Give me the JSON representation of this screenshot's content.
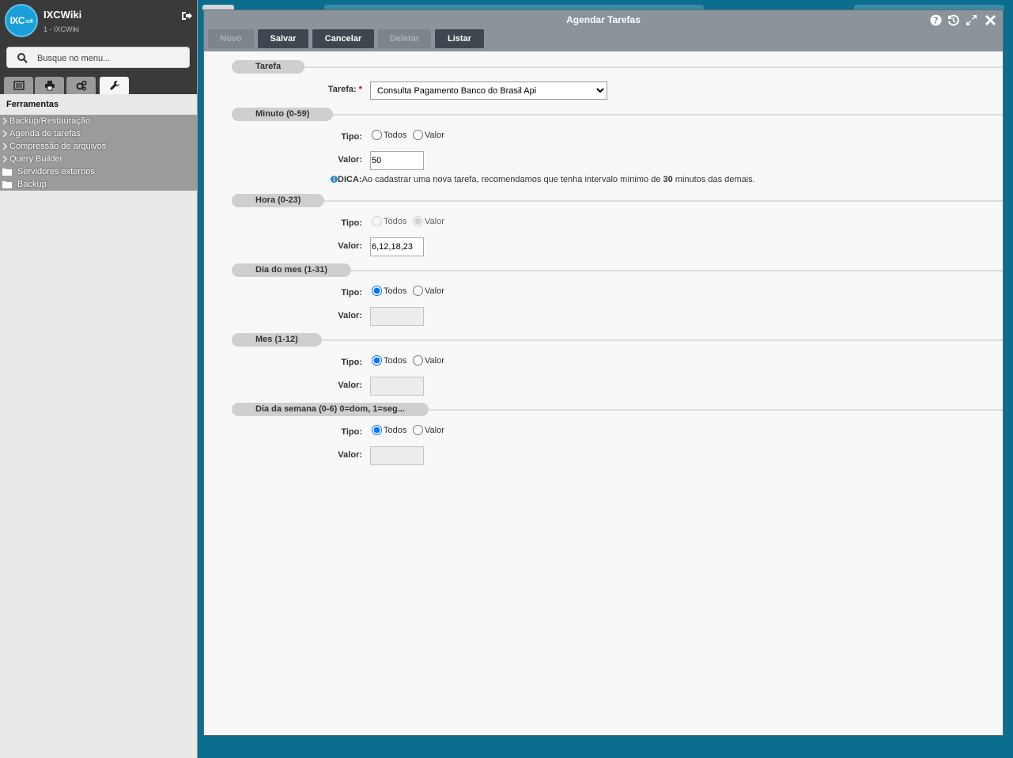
{
  "sidebar": {
    "app_name": "IXCWiki",
    "app_subtitle": "1 - IXCWiki",
    "logo_text": "IXC",
    "logo_small": "soft",
    "search_placeholder": "Busque no menu...",
    "section_title": "Ferramentas",
    "tabs": [
      "list-icon",
      "print-icon",
      "gears-icon",
      "wrench-icon"
    ],
    "items": [
      {
        "label": "Backup/Restauração",
        "type": "group"
      },
      {
        "label": "Agenda de tarefas",
        "type": "group"
      },
      {
        "label": "Compressão de arquivos",
        "type": "group"
      },
      {
        "label": "Query Builder",
        "type": "group"
      },
      {
        "label": "Servidores externos",
        "type": "folder"
      },
      {
        "label": "Backup",
        "type": "folder"
      }
    ]
  },
  "window": {
    "title": "Agendar Tarefas",
    "toolbar": {
      "novo": "Novo",
      "salvar": "Salvar",
      "cancelar": "Cancelar",
      "deletar": "Deletar",
      "listar": "Listar"
    }
  },
  "form": {
    "tarefa": {
      "legend": "Tarefa",
      "label": "Tarefa:",
      "required": "*",
      "value": "Consulta Pagamento Banco do Brasil Api"
    },
    "minuto": {
      "legend": "Minuto (0-59)",
      "tipo_label": "Tipo:",
      "opt_todos": "Todos",
      "opt_valor": "Valor",
      "valor_label": "Valor:",
      "valor": "50",
      "tip_prefix": "DICA:",
      "tip_text_1": "Ao cadastrar uma nova tarefa, recomendamos que tenha intervalo mínimo de ",
      "tip_bold": "30",
      "tip_text_2": " minutos das demais."
    },
    "hora": {
      "legend": "Hora (0-23)",
      "tipo_label": "Tipo:",
      "opt_todos": "Todos",
      "opt_valor": "Valor",
      "valor_label": "Valor:",
      "valor": "6,12,18,23"
    },
    "dia_mes": {
      "legend": "Dia do mes (1-31)",
      "tipo_label": "Tipo:",
      "opt_todos": "Todos",
      "opt_valor": "Valor",
      "valor_label": "Valor:",
      "valor": ""
    },
    "mes": {
      "legend": "Mes (1-12)",
      "tipo_label": "Tipo:",
      "opt_todos": "Todos",
      "opt_valor": "Valor",
      "valor_label": "Valor:",
      "valor": ""
    },
    "dia_semana": {
      "legend": "Dia da semana (0-6) 0=dom, 1=seg...",
      "tipo_label": "Tipo:",
      "opt_todos": "Todos",
      "opt_valor": "Valor",
      "valor_label": "Valor:",
      "valor": ""
    }
  }
}
